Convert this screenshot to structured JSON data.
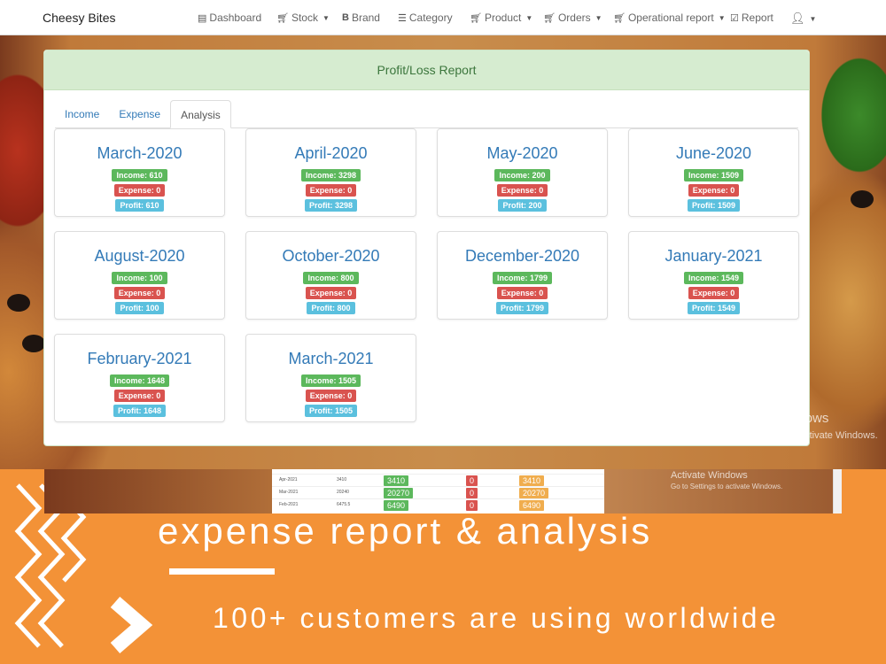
{
  "navbar": {
    "brand": "Cheesy Bites",
    "items": [
      {
        "label": "Dashboard",
        "icon": "dashboard-icon",
        "dropdown": false
      },
      {
        "label": "Stock",
        "icon": "cart-icon",
        "dropdown": true
      },
      {
        "label": "Brand",
        "icon": "bold-b-icon",
        "dropdown": false
      },
      {
        "label": "Category",
        "icon": "list-icon",
        "dropdown": false
      },
      {
        "label": "Product",
        "icon": "cart-icon",
        "dropdown": true
      },
      {
        "label": "Orders",
        "icon": "cart-icon",
        "dropdown": true
      },
      {
        "label": "Operational report",
        "icon": "cart-icon",
        "dropdown": true
      },
      {
        "label": "Report",
        "icon": "check-icon",
        "dropdown": false
      }
    ],
    "user_icon": "user-icon"
  },
  "panel": {
    "title": "Profit/Loss Report",
    "tabs": [
      {
        "label": "Income",
        "active": false
      },
      {
        "label": "Expense",
        "active": false
      },
      {
        "label": "Analysis",
        "active": true
      }
    ],
    "months": [
      {
        "title": "March-2020",
        "income": "Income: 610",
        "expense": "Expense: 0",
        "profit": "Profit: 610"
      },
      {
        "title": "April-2020",
        "income": "Income: 3298",
        "expense": "Expense: 0",
        "profit": "Profit: 3298"
      },
      {
        "title": "May-2020",
        "income": "Income: 200",
        "expense": "Expense: 0",
        "profit": "Profit: 200"
      },
      {
        "title": "June-2020",
        "income": "Income: 1509",
        "expense": "Expense: 0",
        "profit": "Profit: 1509"
      },
      {
        "title": "August-2020",
        "income": "Income: 100",
        "expense": "Expense: 0",
        "profit": "Profit: 100"
      },
      {
        "title": "October-2020",
        "income": "Income: 800",
        "expense": "Expense: 0",
        "profit": "Profit: 800"
      },
      {
        "title": "December-2020",
        "income": "Income: 1799",
        "expense": "Expense: 0",
        "profit": "Profit: 1799"
      },
      {
        "title": "January-2021",
        "income": "Income: 1549",
        "expense": "Expense: 0",
        "profit": "Profit: 1549"
      },
      {
        "title": "February-2021",
        "income": "Income: 1648",
        "expense": "Expense: 0",
        "profit": "Profit: 1648"
      },
      {
        "title": "March-2021",
        "income": "Income: 1505",
        "expense": "Expense: 0",
        "profit": "Profit: 1505"
      }
    ]
  },
  "watermark": {
    "title": "Activate Windows",
    "subtitle": "Go to Settings to activate Windows."
  },
  "inset": {
    "rows": [
      {
        "label": "Apr-2021",
        "val": "3410",
        "income": "3410",
        "expense": "0",
        "profit": "3410"
      },
      {
        "label": "Mar-2021",
        "val": "20240",
        "income": "20270",
        "expense": "0",
        "profit": "20270"
      },
      {
        "label": "Feb-2021",
        "val": "6475.5",
        "income": "6490",
        "expense": "0",
        "profit": "6490"
      }
    ],
    "watermark_title": "Activate Windows",
    "watermark_subtitle": "Go to Settings to activate Windows."
  },
  "promo": {
    "headline": "expense report & analysis",
    "subline": "100+ customers are using worldwide"
  },
  "colors": {
    "income": "#5cb85c",
    "expense": "#d9534f",
    "profit": "#5bc0de",
    "promo": "#f39237",
    "link": "#337ab7"
  }
}
